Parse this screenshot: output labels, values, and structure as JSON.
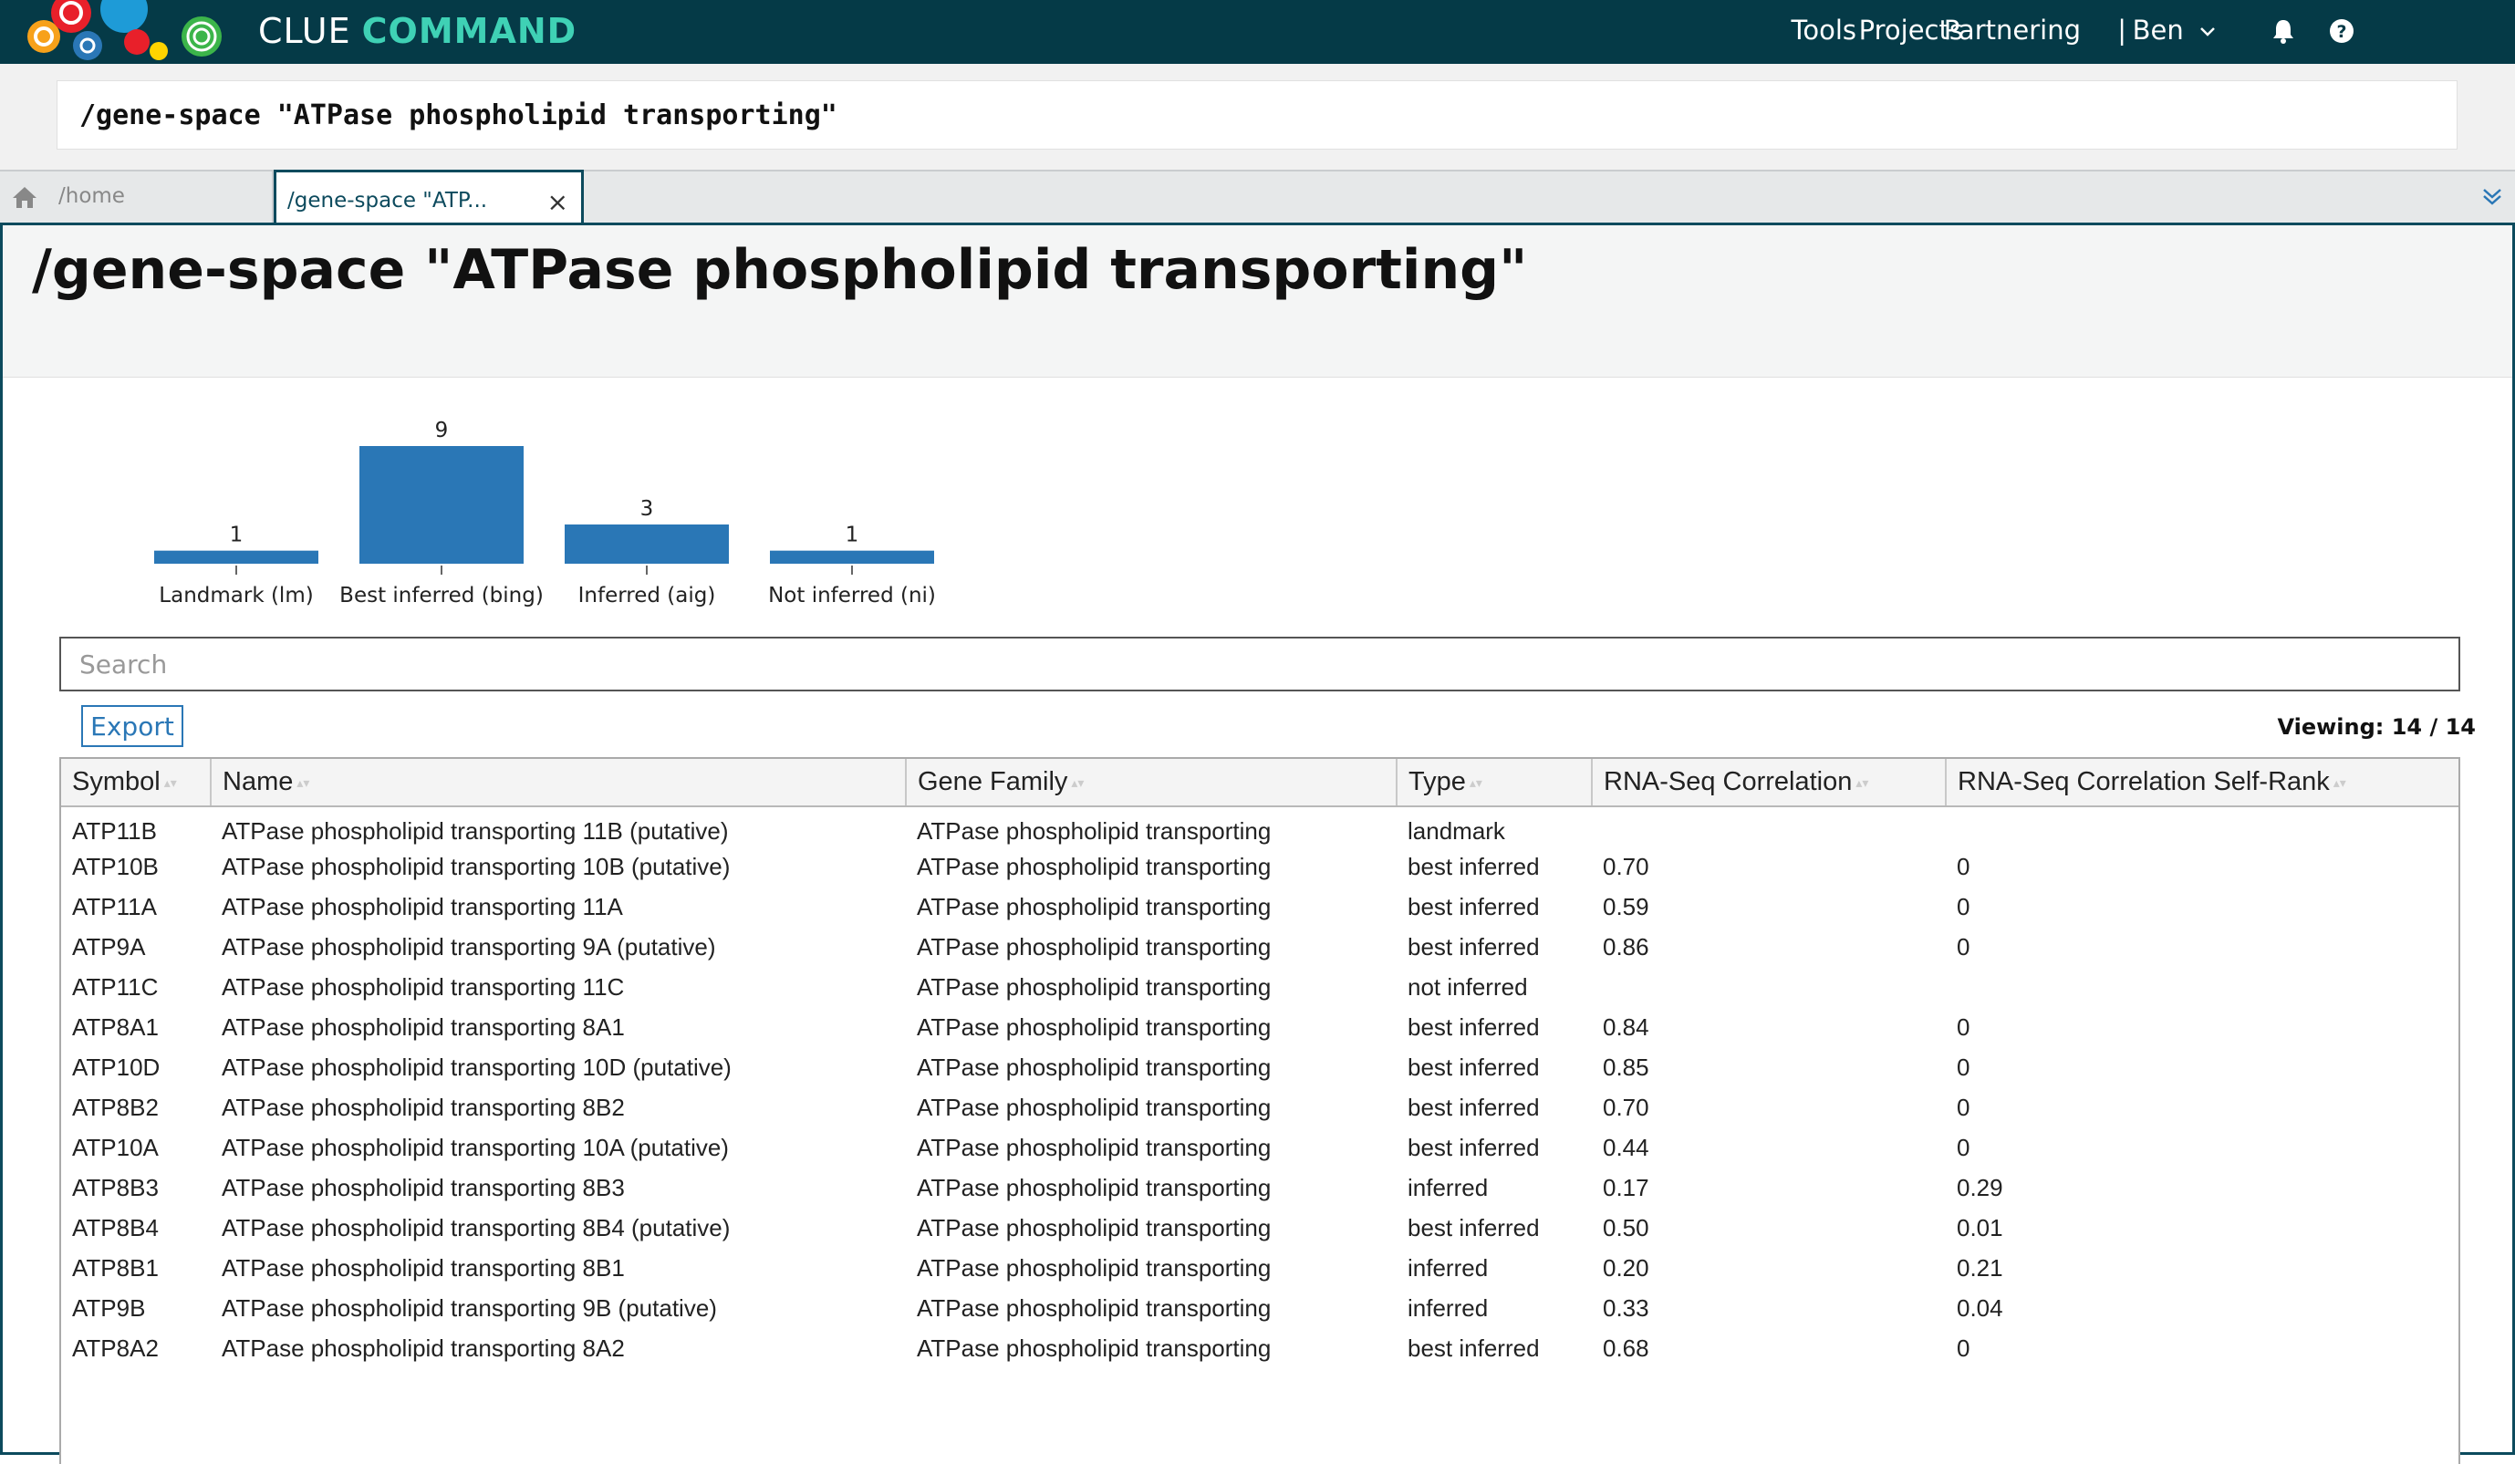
{
  "app": {
    "brand_part1": "CLUE",
    "brand_part2": "COMMAND"
  },
  "nav": {
    "tools": "Tools",
    "projects": "Projects",
    "partnering": "Partnering",
    "separator": "|",
    "user": "Ben"
  },
  "command": {
    "value": "/gene-space \"ATPase phospholipid transporting\""
  },
  "tabs": {
    "home_label": "/home",
    "active_label": "/gene-space \"ATP...",
    "close": "×"
  },
  "page": {
    "title": "/gene-space \"ATPase phospholipid transporting\""
  },
  "chart_data": {
    "type": "bar",
    "categories": [
      "Landmark (lm)",
      "Best inferred (bing)",
      "Inferred (aig)",
      "Not inferred (ni)"
    ],
    "values": [
      1,
      9,
      3,
      1
    ],
    "color": "#2a77b6",
    "ylim": [
      0,
      9
    ]
  },
  "search": {
    "placeholder": "Search"
  },
  "export": {
    "label": "Export"
  },
  "viewing": {
    "label": "Viewing: 14 / 14"
  },
  "table": {
    "columns": [
      "Symbol",
      "Name",
      "Gene Family",
      "Type",
      "RNA-Seq Correlation",
      "RNA-Seq Correlation Self-Rank"
    ],
    "rows": [
      [
        "ATP11B",
        "ATPase phospholipid transporting 11B (putative)",
        "ATPase phospholipid transporting",
        "landmark",
        "",
        ""
      ],
      [
        "ATP10B",
        "ATPase phospholipid transporting 10B (putative)",
        "ATPase phospholipid transporting",
        "best inferred",
        "0.70",
        "0"
      ],
      [
        "ATP11A",
        "ATPase phospholipid transporting 11A",
        "ATPase phospholipid transporting",
        "best inferred",
        "0.59",
        "0"
      ],
      [
        "ATP9A",
        "ATPase phospholipid transporting 9A (putative)",
        "ATPase phospholipid transporting",
        "best inferred",
        "0.86",
        "0"
      ],
      [
        "ATP11C",
        "ATPase phospholipid transporting 11C",
        "ATPase phospholipid transporting",
        "not inferred",
        "",
        ""
      ],
      [
        "ATP8A1",
        "ATPase phospholipid transporting 8A1",
        "ATPase phospholipid transporting",
        "best inferred",
        "0.84",
        "0"
      ],
      [
        "ATP10D",
        "ATPase phospholipid transporting 10D (putative)",
        "ATPase phospholipid transporting",
        "best inferred",
        "0.85",
        "0"
      ],
      [
        "ATP8B2",
        "ATPase phospholipid transporting 8B2",
        "ATPase phospholipid transporting",
        "best inferred",
        "0.70",
        "0"
      ],
      [
        "ATP10A",
        "ATPase phospholipid transporting 10A (putative)",
        "ATPase phospholipid transporting",
        "best inferred",
        "0.44",
        "0"
      ],
      [
        "ATP8B3",
        "ATPase phospholipid transporting 8B3",
        "ATPase phospholipid transporting",
        "inferred",
        "0.17",
        "0.29"
      ],
      [
        "ATP8B4",
        "ATPase phospholipid transporting 8B4 (putative)",
        "ATPase phospholipid transporting",
        "best inferred",
        "0.50",
        "0.01"
      ],
      [
        "ATP8B1",
        "ATPase phospholipid transporting 8B1",
        "ATPase phospholipid transporting",
        "inferred",
        "0.20",
        "0.21"
      ],
      [
        "ATP9B",
        "ATPase phospholipid transporting 9B (putative)",
        "ATPase phospholipid transporting",
        "inferred",
        "0.33",
        "0.04"
      ],
      [
        "ATP8A2",
        "ATPase phospholipid transporting 8A2",
        "ATPase phospholipid transporting",
        "best inferred",
        "0.68",
        "0"
      ]
    ]
  },
  "icons": {
    "logo": "clue-logo",
    "user_menu": "chevron-down-icon",
    "notifications": "bell-icon",
    "help": "help-icon",
    "home": "home-icon",
    "tab_overflow": "chevron-down-icon"
  }
}
